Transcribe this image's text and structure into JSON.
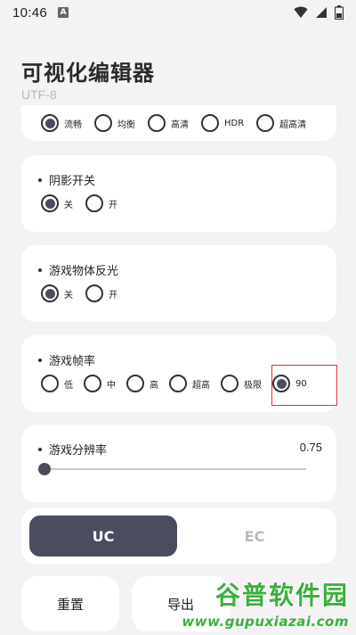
{
  "status_bar": {
    "time": "10:46",
    "notif_letter": "A"
  },
  "app": {
    "title": "可视化编辑器",
    "subtitle": "UTF-8"
  },
  "quality": {
    "options": [
      "流畅",
      "均衡",
      "高清",
      "HDR",
      "超高清"
    ],
    "selected_index": 0
  },
  "shadow": {
    "label": "阴影开关",
    "options": [
      "关",
      "开"
    ],
    "selected_index": 0
  },
  "reflection": {
    "label": "游戏物体反光",
    "options": [
      "关",
      "开"
    ],
    "selected_index": 0
  },
  "framerate": {
    "label": "游戏帧率",
    "options": [
      "低",
      "中",
      "高",
      "超高",
      "极限",
      "90"
    ],
    "selected_index": 5
  },
  "resolution": {
    "label": "游戏分辨率",
    "value": "0.75",
    "slider_fraction": 0
  },
  "tabs": {
    "items": [
      "UC",
      "EC"
    ],
    "active_index": 0
  },
  "actions": {
    "reset": "重置",
    "export": "导出"
  },
  "watermark": {
    "top": "谷普软件园",
    "bottom": "www.gupuxiazai.com"
  },
  "colors": {
    "accent": "#4a4d5e",
    "background": "#f3f3f6",
    "highlight": "#dd3333",
    "watermark": "#3bb03b"
  }
}
